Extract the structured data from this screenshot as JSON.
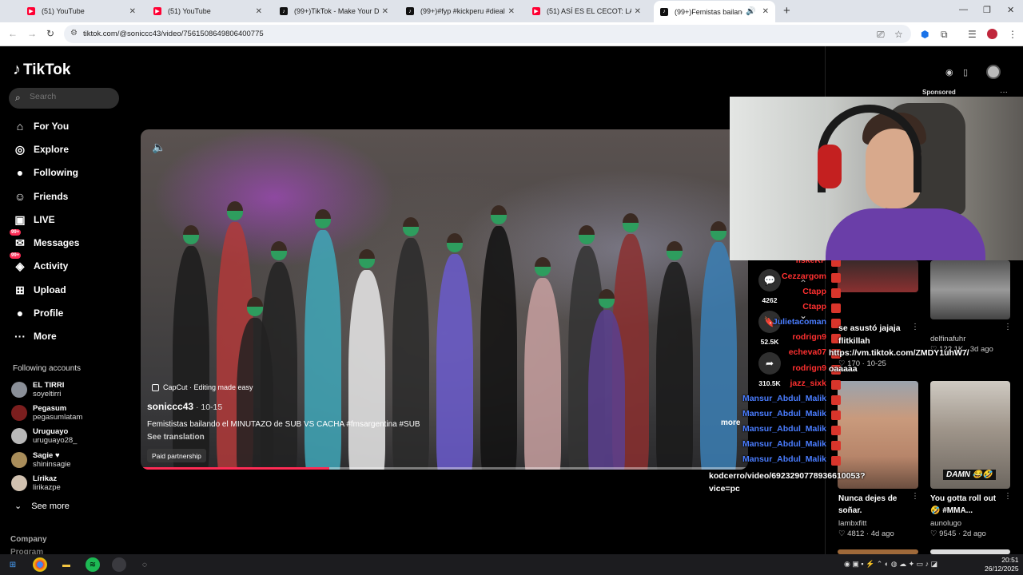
{
  "browser": {
    "tabs": [
      {
        "title": "(51) YouTube",
        "favicon": "youtube-icon"
      },
      {
        "title": "(51) YouTube",
        "favicon": "youtube-icon"
      },
      {
        "title": "(99+)TikTok - Make Your Day",
        "favicon": "tiktok-icon"
      },
      {
        "title": "(99+)#fyp #kickperu #diealis | T",
        "favicon": "tiktok-icon"
      },
      {
        "title": "(51) ASÍ ES EL CECOT: LA CÁRCE",
        "favicon": "youtube-icon"
      },
      {
        "title": "(99+)Femistas bailando el M",
        "favicon": "tiktok-icon"
      }
    ],
    "new_tab": "+",
    "url": "tiktok.com/@soniccc43/video/7561508649806400775"
  },
  "sidebar": {
    "logo": "TikTok",
    "search_placeholder": "Search",
    "nav": [
      {
        "label": "For You",
        "icon": "home-icon",
        "glyph": "⌂"
      },
      {
        "label": "Explore",
        "icon": "compass-icon",
        "glyph": "◎"
      },
      {
        "label": "Following",
        "icon": "avatar-icon",
        "glyph": "●"
      },
      {
        "label": "Friends",
        "icon": "friends-icon",
        "glyph": "☺"
      },
      {
        "label": "LIVE",
        "icon": "live-icon",
        "glyph": "▣"
      },
      {
        "label": "Messages",
        "icon": "messages-icon",
        "glyph": "✉",
        "badge": "99+"
      },
      {
        "label": "Activity",
        "icon": "activity-icon",
        "glyph": "◈",
        "badge": "99+"
      },
      {
        "label": "Upload",
        "icon": "upload-icon",
        "glyph": "⊞"
      },
      {
        "label": "Profile",
        "icon": "profile-icon",
        "glyph": "●"
      },
      {
        "label": "More",
        "icon": "more-icon",
        "glyph": "···"
      }
    ],
    "following_header": "Following accounts",
    "accounts": [
      {
        "name": "EL TIRRI",
        "handle": "soyeltirri"
      },
      {
        "name": "Pegasum",
        "handle": "pegasumlatam"
      },
      {
        "name": "Uruguayo",
        "handle": "uruguayo28_"
      },
      {
        "name": "Sagie ♥",
        "handle": "shininsagie"
      },
      {
        "name": "Lírikaz",
        "handle": "lirikazpe"
      }
    ],
    "see_more": "See more",
    "company": "Company",
    "program": "Program"
  },
  "video": {
    "capcut": "CapCut · Editing made easy",
    "author": "soniccc43",
    "date": " · 10-15",
    "description": "Femististas bailando el MINUTAZO de SUB VS CACHA #fmsargentina #SUB",
    "see_translation": "See translation",
    "more": "more",
    "paid": "Paid partnership",
    "progress": 0.31
  },
  "actions": {
    "comments": "4262",
    "saves": "52.5K",
    "shares": "310.5K"
  },
  "chat": [
    {
      "text": "fiskeRP",
      "color": "red"
    },
    {
      "text": "Cezzargom",
      "color": "red"
    },
    {
      "text": "Ctapp",
      "color": "red"
    },
    {
      "text": "Ctapp",
      "color": "red"
    },
    {
      "text": "Julietacoman",
      "color": "blue"
    },
    {
      "text": "rodrign9",
      "color": "red"
    },
    {
      "text": "echeva07",
      "color": "red"
    },
    {
      "text": "rodrign9",
      "color": "red"
    },
    {
      "text": "jazz_sixk",
      "color": "red"
    },
    {
      "text": "Mansur_Abdul_Malik",
      "color": "blue"
    },
    {
      "text": "Mansur_Abdul_Malik",
      "color": "blue"
    },
    {
      "text": "Mansur_Abdul_Malik",
      "color": "blue"
    },
    {
      "text": "Mansur_Abdul_Malik",
      "color": "blue"
    },
    {
      "text": "Mansur_Abdul_Malik",
      "color": "blue"
    }
  ],
  "chat_messages": {
    "m1": "se asustó jajaja",
    "m2": "flitkillah",
    "m3": "https://vm.tiktok.com/ZMDY1uhW7/",
    "m4": "oaaaaa",
    "m5": "kodcerro/video/6923290778936610053?",
    "m6": "vice=pc"
  },
  "recommendations": {
    "sponsored": "Sponsored",
    "items": [
      {
        "title": "",
        "user": "delfinafuhr",
        "likes": "122.1K",
        "age": "3d ago"
      },
      {
        "title": "",
        "user": "",
        "likes": "170",
        "age": "10-25"
      },
      {
        "title": "Nunca dejes de soñar.",
        "user": "lambxfitt",
        "likes": "4812",
        "age": "4d ago"
      },
      {
        "title": "You gotta roll out 🤣 #MMA...",
        "user": "aunolugo",
        "likes": "9545",
        "age": "2d ago"
      }
    ],
    "thumb_caption": "DAMN 😂🤣"
  },
  "taskbar": {
    "time": "20:51",
    "date": "26/12/2025"
  },
  "colors": {
    "accent": "#fe2c55",
    "chat_red": "#ff3030",
    "chat_blue": "#4a7dff"
  }
}
